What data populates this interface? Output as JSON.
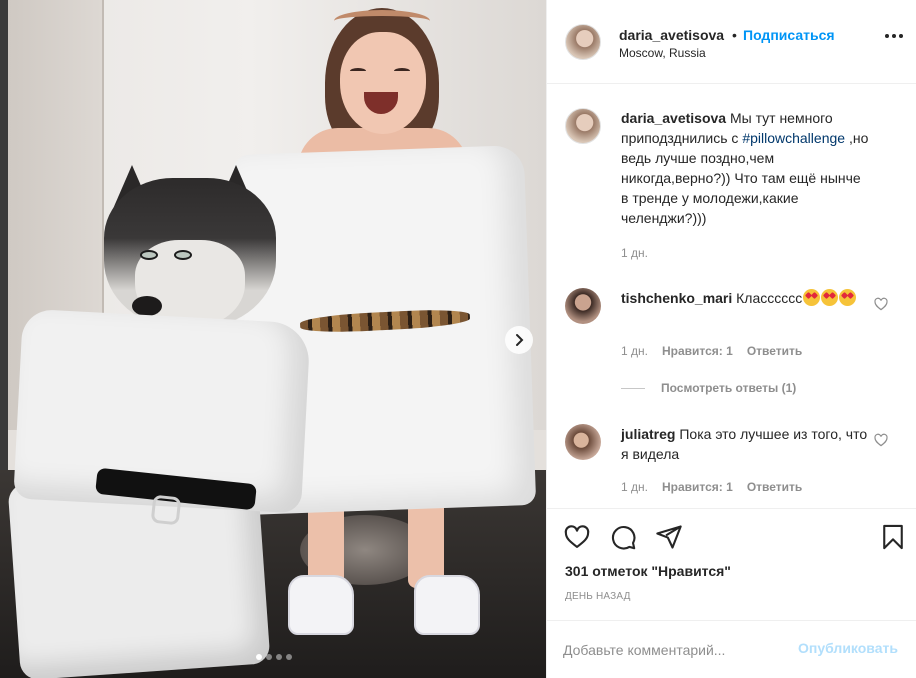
{
  "post_header": {
    "username": "daria_avetisova",
    "separator": "•",
    "follow_label": "Подписаться",
    "location": "Moscow, Russia"
  },
  "caption": {
    "username": "daria_avetisova",
    "text_before": " Мы тут немного приподзднились с ",
    "hashtag": "#pillowchallenge",
    "text_after": " ,но ведь лучше поздно,чем никогда,верно?)) Что там ещё нынче в тренде у молодежи,какие челенджи?)))",
    "time": "1 дн."
  },
  "comments": [
    {
      "username": "tishchenko_mari",
      "text": " Класссссс",
      "emoji_count": 3,
      "time": "1 дн.",
      "likes_label": "Нравится: 1",
      "reply_label": "Ответить",
      "view_replies": "Посмотреть ответы (1)"
    },
    {
      "username": "juliatreg",
      "text": " Пока это лучшее из того, что я видела",
      "time": "1 дн.",
      "likes_label": "Нравится: 1",
      "reply_label": "Ответить"
    }
  ],
  "likes_text": "301 отметок \"Нравится\"",
  "posted_time": "ДЕНЬ НАЗАД",
  "add_comment": {
    "placeholder": "Добавьте комментарий...",
    "publish_label": "Опубликовать"
  },
  "icons": [
    "heart-icon",
    "comment-icon",
    "share-icon",
    "bookmark-icon",
    "more-icon",
    "chevron-right-icon"
  ],
  "colors": {
    "link": "#0095f6",
    "hashtag": "#00376b",
    "muted": "#8e8e8e",
    "publish_disabled": "#b2dffc"
  },
  "carousel": {
    "slides": 4,
    "active_slide": 1
  }
}
